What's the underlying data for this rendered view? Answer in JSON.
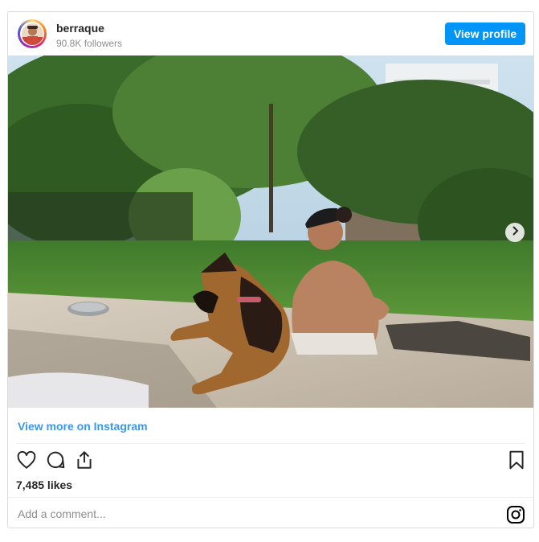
{
  "header": {
    "username": "berraque",
    "followers": "90.8K followers",
    "view_profile_label": "View profile"
  },
  "post": {
    "image_icon": "photo-dog-and-woman-in-garden",
    "next_icon": "chevron-right-icon",
    "view_more_label": "View more on Instagram",
    "likes": "7,485 likes"
  },
  "actions": {
    "like_icon": "heart-icon",
    "comment_icon": "comment-icon",
    "share_icon": "share-icon",
    "save_icon": "bookmark-icon"
  },
  "comment": {
    "placeholder": "Add a comment...",
    "logo_icon": "instagram-icon"
  },
  "colors": {
    "accent": "#0095f6",
    "link": "#3897f0",
    "text": "#262626",
    "muted": "#8e8e8e"
  }
}
